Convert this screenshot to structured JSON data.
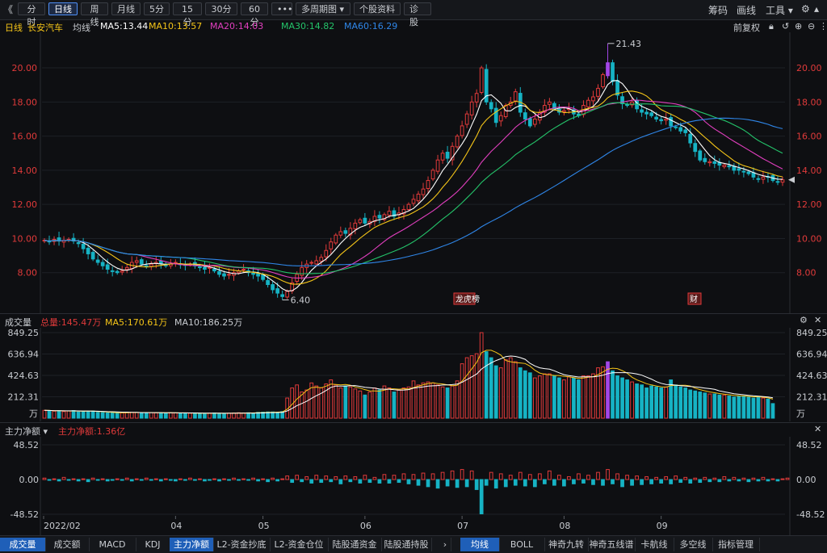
{
  "toolbar": {
    "collapse": "《",
    "periods": [
      "分时",
      "日线",
      "周线",
      "月线",
      "5分",
      "15分",
      "30分",
      "60分"
    ],
    "more": "•••",
    "multi_period": "多周期图",
    "stock_info": "个股资料",
    "diagnosis": "诊股",
    "chip": "筹码",
    "draw": "画线",
    "tools": "工具"
  },
  "main": {
    "period_label": "日线",
    "stock_name": "长安汽车",
    "ma_label": "均线",
    "ma5": "MA5:13.44",
    "ma10": "MA10:13.57",
    "ma20": "MA20:14.03",
    "ma30": "MA30:14.82",
    "ma60": "MA60:16.29",
    "adjust": "前复权",
    "high_label": "21.43",
    "low_label": "6.40",
    "badge1": "龙虎榜",
    "badge2": "财"
  },
  "volume_panel": {
    "title": "成交量",
    "total": "总量:145.47万",
    "ma5": "MA5:170.61万",
    "ma10": "MA10:186.25万",
    "unit": "万"
  },
  "flow_panel": {
    "title": "主力净额",
    "value": "主力净额:1.36亿"
  },
  "bottom_tabs_left": [
    "成交量",
    "成交额",
    "MACD",
    "KDJ",
    "主力净额",
    "L2-资金抄底",
    "L2-资金仓位",
    "陆股通资金",
    "陆股通持股"
  ],
  "bottom_tabs_right": [
    "均线",
    "BOLL",
    "神奇九转",
    "神奇五线谱",
    "卡航线",
    "多空线",
    "指标管理"
  ],
  "colors": {
    "up": "#e03a3a",
    "down": "#16b3c4",
    "ma5": "#ffffff",
    "ma10": "#f5c518",
    "ma20": "#e23fbf",
    "ma30": "#24c46a",
    "ma60": "#2f86e8",
    "spike": "#a246e8"
  },
  "chart_data": [
    {
      "type": "candlestick",
      "title": "长安汽车 日线",
      "x_tick_labels": [
        "2022/02",
        "04",
        "05",
        "06",
        "07",
        "08",
        "09"
      ],
      "y_tick_labels": [
        "8.00",
        "10.00",
        "12.00",
        "14.00",
        "16.00",
        "18.00",
        "20.00"
      ],
      "ylim": [
        6.0,
        21.8
      ],
      "annotations": [
        {
          "label": "21.43",
          "value": 21.43
        },
        {
          "label": "6.40",
          "value": 6.4
        }
      ],
      "close": [
        9.9,
        9.8,
        9.95,
        9.85,
        9.9,
        9.95,
        9.85,
        9.7,
        9.4,
        9.1,
        8.8,
        8.6,
        8.4,
        8.2,
        8.1,
        8.0,
        8.1,
        8.3,
        8.6,
        8.7,
        8.5,
        8.4,
        8.5,
        8.6,
        8.55,
        8.4,
        8.5,
        8.6,
        8.5,
        8.45,
        8.5,
        8.4,
        8.3,
        8.2,
        8.3,
        8.1,
        7.9,
        7.8,
        7.9,
        8.0,
        8.1,
        8.2,
        8.0,
        7.9,
        7.8,
        7.6,
        7.3,
        7.0,
        6.8,
        6.6,
        6.9,
        7.4,
        7.9,
        8.3,
        8.5,
        8.6,
        8.7,
        8.9,
        9.3,
        9.8,
        10.2,
        10.4,
        10.3,
        10.6,
        10.9,
        11.1,
        10.9,
        11.0,
        11.3,
        11.2,
        11.4,
        11.6,
        11.3,
        11.5,
        11.7,
        12.0,
        12.3,
        12.6,
        12.9,
        13.4,
        14.0,
        14.6,
        15.0,
        14.7,
        15.4,
        16.0,
        16.6,
        17.3,
        18.0,
        18.5,
        20.0,
        18.0,
        17.6,
        16.8,
        17.2,
        17.8,
        18.0,
        18.6,
        17.4,
        17.0,
        16.6,
        17.0,
        17.4,
        17.8,
        18.0,
        17.6,
        17.4,
        17.5,
        17.6,
        17.3,
        17.2,
        17.8,
        18.1,
        18.3,
        18.8,
        19.6,
        20.3,
        19.2,
        18.4,
        17.9,
        17.8,
        18.0,
        17.6,
        17.4,
        17.3,
        17.2,
        17.0,
        16.9,
        17.0,
        16.6,
        16.5,
        16.3,
        16.2,
        15.6,
        15.1,
        14.6,
        14.5,
        14.5,
        14.4,
        14.3,
        14.3,
        14.2,
        14.0,
        14.0,
        13.9,
        13.8,
        13.6,
        13.5,
        13.6,
        13.6,
        13.4,
        13.3,
        13.44
      ],
      "volume": [
        78,
        76,
        70,
        74,
        66,
        72,
        76,
        62,
        70,
        68,
        72,
        58,
        56,
        52,
        52,
        56,
        54,
        60,
        58,
        56,
        54,
        52,
        56,
        54,
        52,
        52,
        54,
        52,
        50,
        52,
        50,
        48,
        46,
        48,
        50,
        52,
        48,
        46,
        50,
        52,
        54,
        52,
        54,
        50,
        58,
        60,
        62,
        62,
        58,
        66,
        200,
        300,
        330,
        260,
        280,
        350,
        320,
        300,
        340,
        380,
        330,
        300,
        320,
        310,
        290,
        270,
        230,
        260,
        300,
        280,
        320,
        300,
        260,
        280,
        300,
        310,
        370,
        330,
        350,
        360,
        350,
        330,
        310,
        300,
        320,
        370,
        540,
        600,
        620,
        640,
        849,
        660,
        600,
        520,
        500,
        580,
        600,
        560,
        500,
        470,
        450,
        400,
        420,
        440,
        440,
        420,
        400,
        380,
        410,
        400,
        380,
        420,
        420,
        440,
        500,
        510,
        560,
        470,
        420,
        400,
        380,
        360,
        340,
        330,
        300,
        320,
        310,
        300,
        310,
        380,
        330,
        310,
        300,
        280,
        270,
        260,
        250,
        240,
        240,
        230,
        230,
        220,
        210,
        220,
        220,
        210,
        200,
        210,
        200,
        190,
        145
      ],
      "net_flow": [
        2,
        -1,
        1,
        -2,
        3,
        -1,
        1,
        -2,
        1,
        -3,
        2,
        -1,
        1,
        -2,
        -1,
        1,
        -1,
        2,
        -2,
        1,
        -1,
        2,
        -1,
        1,
        -2,
        1,
        -1,
        -2,
        1,
        -1,
        2,
        -1,
        1,
        -2,
        -1,
        1,
        -2,
        1,
        -1,
        2,
        -1,
        1,
        -1,
        2,
        -2,
        1,
        -3,
        2,
        -2,
        1,
        5,
        -4,
        6,
        -3,
        4,
        -5,
        6,
        -4,
        5,
        -3,
        4,
        -6,
        5,
        -3,
        4,
        -5,
        6,
        -4,
        3,
        -5,
        7,
        -5,
        6,
        -4,
        8,
        -6,
        7,
        -8,
        9,
        -10,
        8,
        -12,
        10,
        -9,
        12,
        -11,
        14,
        -10,
        12,
        -14,
        -48,
        -8,
        10,
        -12,
        8,
        -10,
        6,
        -8,
        10,
        -9,
        7,
        -10,
        8,
        -6,
        12,
        -8,
        6,
        -9,
        4,
        -6,
        8,
        -5,
        6,
        -7,
        10,
        -8,
        14,
        -6,
        8,
        -10,
        6,
        -8,
        5,
        -7,
        4,
        -6,
        3,
        -5,
        4,
        -6,
        5,
        -4,
        3,
        -5,
        2,
        -4,
        3,
        -3,
        2,
        -3,
        4,
        -2,
        3,
        -2,
        2,
        -3,
        2,
        -2,
        3,
        -2,
        1,
        -2,
        1,
        2
      ]
    }
  ]
}
